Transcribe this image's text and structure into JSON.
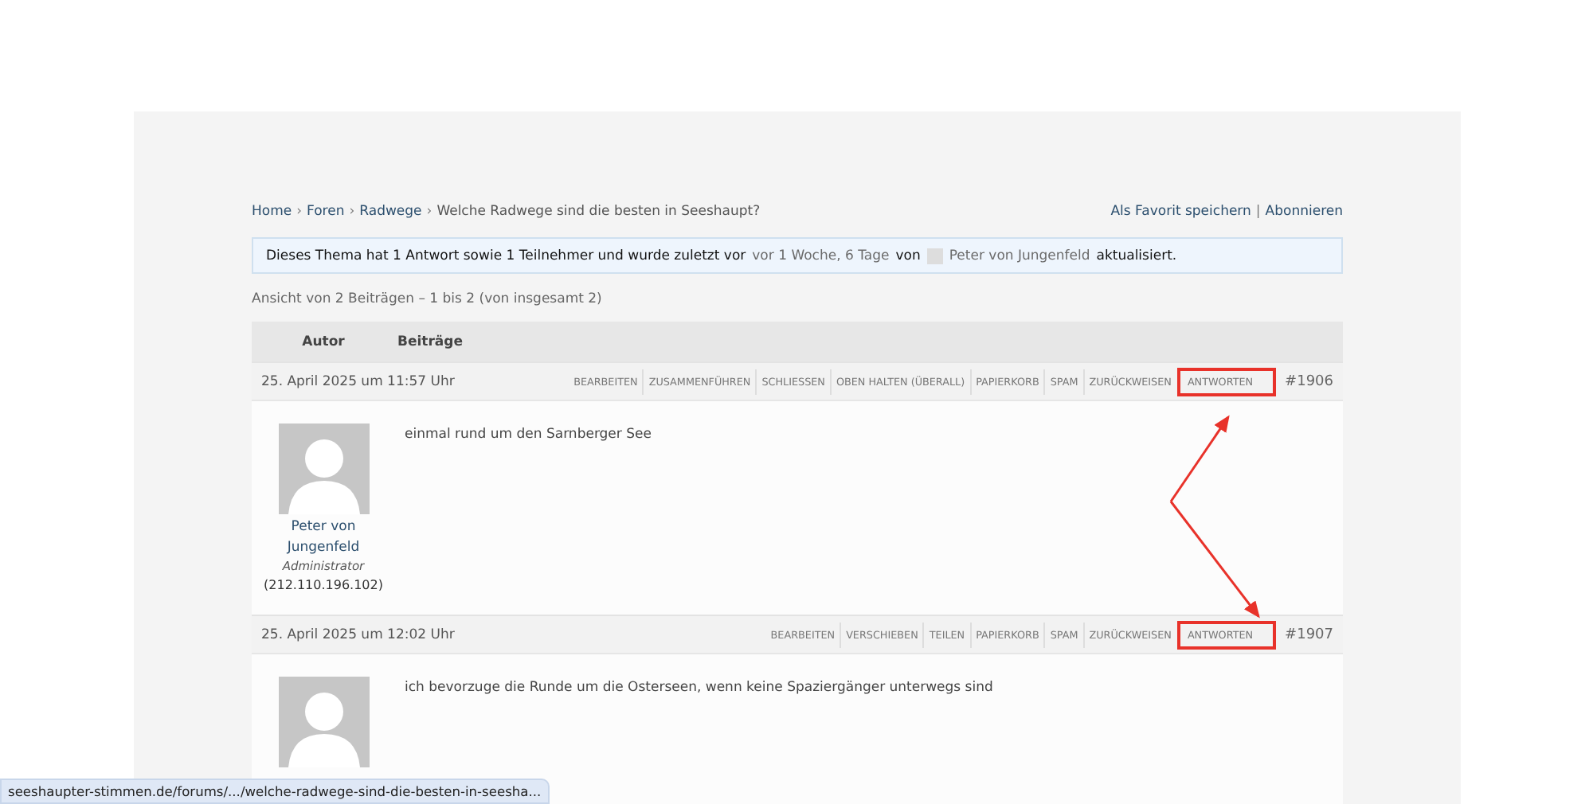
{
  "breadcrumb": {
    "separator": "›",
    "links": [
      "Home",
      "Foren",
      "Radwege"
    ],
    "current": "Welche Radwege sind die besten in Seeshaupt?"
  },
  "topic_actions": {
    "separator": "|",
    "links": [
      "Als Favorit speichern",
      "Abonnieren"
    ]
  },
  "notice": {
    "before": "Dieses Thema hat 1 Antwort sowie 1 Teilnehmer und wurde zuletzt vor",
    "time_link": "vor 1 Woche, 6 Tage",
    "by": "von",
    "author_link": "Peter von Jungenfeld",
    "after": "aktualisiert."
  },
  "pagination_info": "Ansicht von 2 Beiträgen – 1 bis 2 (von insgesamt 2)",
  "table": {
    "columns": [
      "Autor",
      "Beiträge"
    ]
  },
  "posts": [
    {
      "date": "25. April 2025 um 11:57 Uhr",
      "number": "#1906",
      "actions": [
        {
          "label": "BEARBEITEN",
          "highlighted": false
        },
        {
          "label": "ZUSAMMENFÜHREN",
          "highlighted": false
        },
        {
          "label": "SCHLIESSEN",
          "highlighted": false
        },
        {
          "label": "OBEN HALTEN (ÜBERALL)",
          "highlighted": false
        },
        {
          "label": "PAPIERKORB",
          "highlighted": false
        },
        {
          "label": "SPAM",
          "highlighted": false
        },
        {
          "label": "ZURÜCKWEISEN",
          "highlighted": false
        },
        {
          "label": "ANTWORTEN",
          "highlighted": true
        }
      ],
      "author": {
        "name": "Peter von Jungenfeld",
        "role": "Administrator",
        "ip": "(212.110.196.102)"
      },
      "content": "einmal rund um den Sarnberger See"
    },
    {
      "date": "25. April 2025 um 12:02 Uhr",
      "number": "#1907",
      "actions": [
        {
          "label": "BEARBEITEN",
          "highlighted": false
        },
        {
          "label": "VERSCHIEBEN",
          "highlighted": false
        },
        {
          "label": "TEILEN",
          "highlighted": false
        },
        {
          "label": "PAPIERKORB",
          "highlighted": false
        },
        {
          "label": "SPAM",
          "highlighted": false
        },
        {
          "label": "ZURÜCKWEISEN",
          "highlighted": false
        },
        {
          "label": "ANTWORTEN",
          "highlighted": true
        }
      ],
      "content": "ich bevorzuge die Runde um die Osterseen, wenn keine Spaziergänger unterwegs sind"
    }
  ],
  "status_bar": {
    "url": "seeshaupter-stimmen.de/forums/.../welche-radwege-sind-die-besten-in-seesha..."
  }
}
